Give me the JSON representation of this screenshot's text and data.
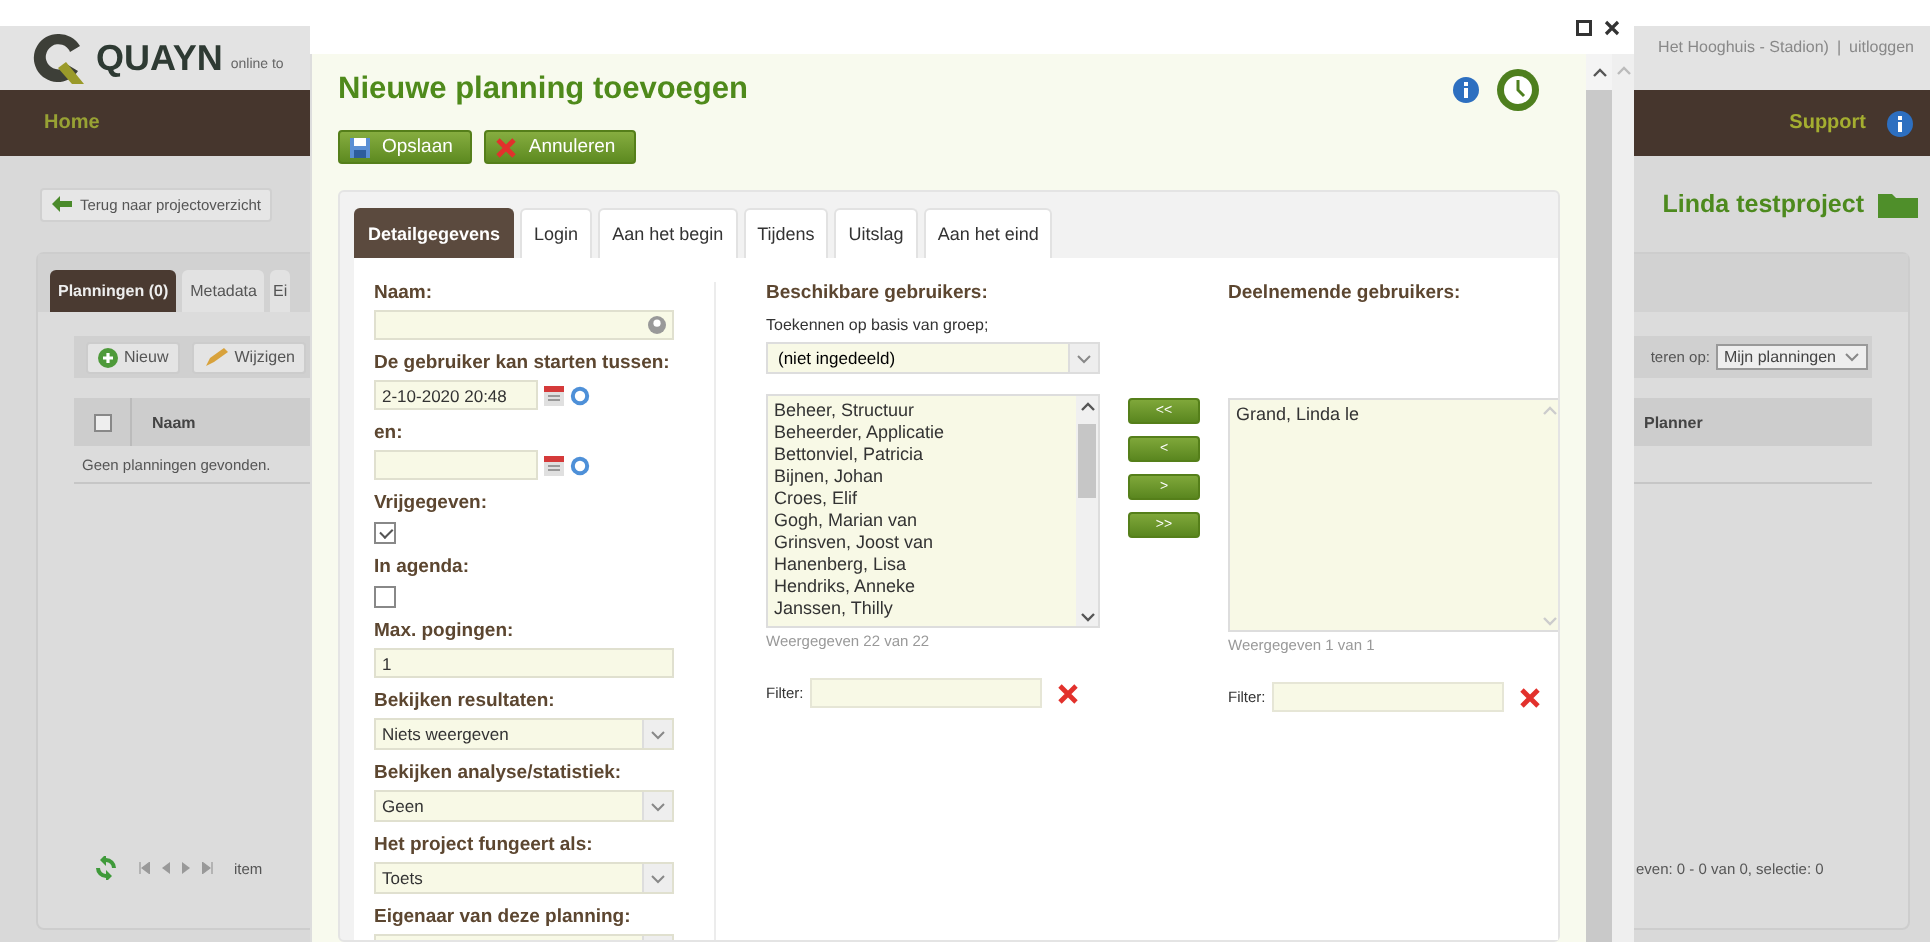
{
  "background_page": {
    "logo": {
      "name": "QUAYN",
      "tagline": "online to"
    },
    "account": {
      "text": "Het Hooghuis - Stadion)",
      "separator": "|",
      "logout": "uitloggen"
    },
    "nav": {
      "home": "Home",
      "support": "Support"
    },
    "back_button": "Terug naar projectoverzicht",
    "project_title": "Linda testproject",
    "tabs": [
      {
        "label": "Planningen (0)",
        "selected": true
      },
      {
        "label": "Metadata",
        "selected": false
      },
      {
        "label": "Ei",
        "selected": false
      }
    ],
    "toolbar": [
      {
        "label": "Nieuw",
        "kind": "new"
      },
      {
        "label": "Wijzigen",
        "kind": "edit"
      }
    ],
    "filter": {
      "label": "teren op:",
      "value": "Mijn planningen"
    },
    "table": {
      "select_all_checked": false,
      "columns": [
        "Naam",
        "Planner"
      ],
      "empty_text": "Geen planningen gevonden."
    },
    "pager": {
      "items_text": "item",
      "summary": "even: 0 - 0 van 0, selectie: 0"
    }
  },
  "dialog": {
    "title": "Nieuwe planning toevoegen",
    "actions": [
      {
        "label": "Opslaan",
        "kind": "save"
      },
      {
        "label": "Annuleren",
        "kind": "cancel"
      }
    ],
    "tabs": [
      {
        "label": "Detailgegevens",
        "selected": true
      },
      {
        "label": "Login",
        "selected": false
      },
      {
        "label": "Aan het begin",
        "selected": false
      },
      {
        "label": "Tijdens",
        "selected": false
      },
      {
        "label": "Uitslag",
        "selected": false
      },
      {
        "label": "Aan het eind",
        "selected": false
      }
    ],
    "form": [
      {
        "label": "Naam:",
        "kind": "lookup"
      },
      {
        "label": "De gebruiker kan starten tussen:",
        "kind": "datetime",
        "value": "2-10-2020 20:48"
      },
      {
        "label": "en:",
        "kind": "datetime"
      },
      {
        "label": "Vrijgegeven:",
        "kind": "checkbox",
        "checked": true
      },
      {
        "label": "In agenda:",
        "kind": "checkbox",
        "checked": false
      },
      {
        "label": "Max. pogingen:",
        "kind": "text",
        "value": "1"
      },
      {
        "label": "Bekijken resultaten:",
        "kind": "select",
        "value": "Niets weergeven"
      },
      {
        "label": "Bekijken analyse/statistiek:",
        "kind": "select",
        "value": "Geen"
      },
      {
        "label": "Het project fungeert als:",
        "kind": "select",
        "value": "Toets"
      },
      {
        "label": "Eigenaar van deze planning:",
        "kind": "select"
      }
    ],
    "available": {
      "heading": "Beschikbare gebruikers:",
      "group_label": "Toekennen op basis van groep;",
      "group_value": "(niet ingedeeld)",
      "users": [
        "Beheer, Structuur",
        "Beheerder, Applicatie",
        "Bettonviel, Patricia",
        "Bijnen, Johan",
        "Croes, Elif",
        "Gogh, Marian van",
        "Grinsven, Joost van",
        "Hanenberg, Lisa",
        "Hendriks, Anneke",
        "Janssen, Thilly"
      ],
      "count": "Weergegeven 22 van 22",
      "filter_label": "Filter:"
    },
    "transfer_buttons": [
      "<<",
      "<",
      ">",
      ">>"
    ],
    "participating": {
      "heading": "Deelnemende gebruikers:",
      "users": [
        "Grand, Linda le"
      ],
      "count": "Weergegeven 1 van 1",
      "filter_label": "Filter:"
    }
  }
}
